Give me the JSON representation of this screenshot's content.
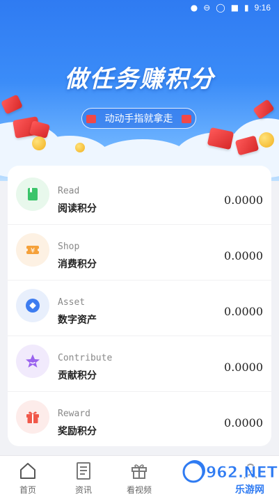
{
  "status_bar": {
    "time": "9:16"
  },
  "banner": {
    "title": "做任务赚积分",
    "pill_text": "动动手指就拿走"
  },
  "rows": [
    {
      "en": "Read",
      "zh": "阅读积分",
      "value": "0.0000",
      "icon": "book-icon",
      "icon_bg": "#e8f8ec",
      "icon_color": "#3bc46a"
    },
    {
      "en": "Shop",
      "zh": "消费积分",
      "value": "0.0000",
      "icon": "yen-ticket-icon",
      "icon_bg": "#fdf1e3",
      "icon_color": "#f5a13a"
    },
    {
      "en": "Asset",
      "zh": "数字资产",
      "value": "0.0000",
      "icon": "asset-coin-icon",
      "icon_bg": "#e8effc",
      "icon_color": "#3d7cf0"
    },
    {
      "en": "Contribute",
      "zh": "贡献积分",
      "value": "0.0000",
      "icon": "star-icon",
      "icon_bg": "#f1eafc",
      "icon_color": "#9a63ee"
    },
    {
      "en": "Reward",
      "zh": "奖励积分",
      "value": "0.0000",
      "icon": "gift-icon",
      "icon_bg": "#fdecea",
      "icon_color": "#f0584a"
    }
  ],
  "bottom_nav": {
    "items": [
      {
        "label": "首页",
        "icon": "home-icon"
      },
      {
        "label": "资讯",
        "icon": "news-icon"
      },
      {
        "label": "看视频",
        "icon": "gift-box-icon"
      }
    ]
  },
  "watermark": {
    "text_top": "962.NET",
    "text_bottom": "乐游网"
  },
  "colors": {
    "brand_blue": "#2f7bf2",
    "card_bg": "#ffffff",
    "page_bg": "#f1f2f6"
  }
}
